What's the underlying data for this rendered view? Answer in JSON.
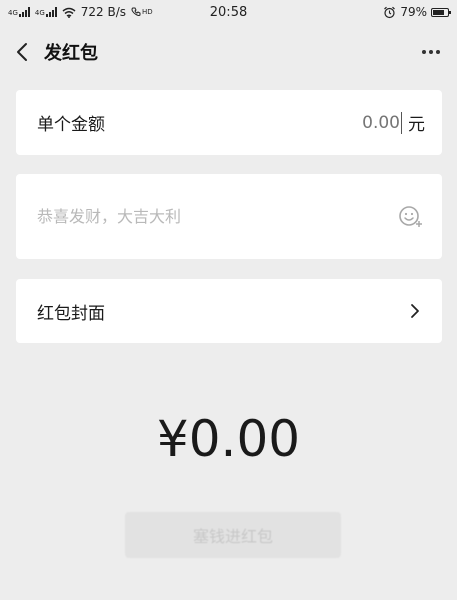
{
  "status_bar": {
    "network_1": "4G",
    "network_2": "4G",
    "speed": "722 B/s",
    "volte": "HD",
    "time": "20:58",
    "battery": "79%",
    "battery_level": 0.79
  },
  "nav": {
    "title": "发红包"
  },
  "amount_card": {
    "label": "单个金额",
    "placeholder": "0.00",
    "unit": "元"
  },
  "greeting_card": {
    "placeholder": "恭喜发财，大吉大利"
  },
  "cover_card": {
    "label": "红包封面"
  },
  "total": "¥0.00",
  "send_button_label": "塞钱进红包",
  "colors": {
    "background": "#ededed",
    "card": "#ffffff",
    "button_disabled": "#e2e2e2"
  }
}
